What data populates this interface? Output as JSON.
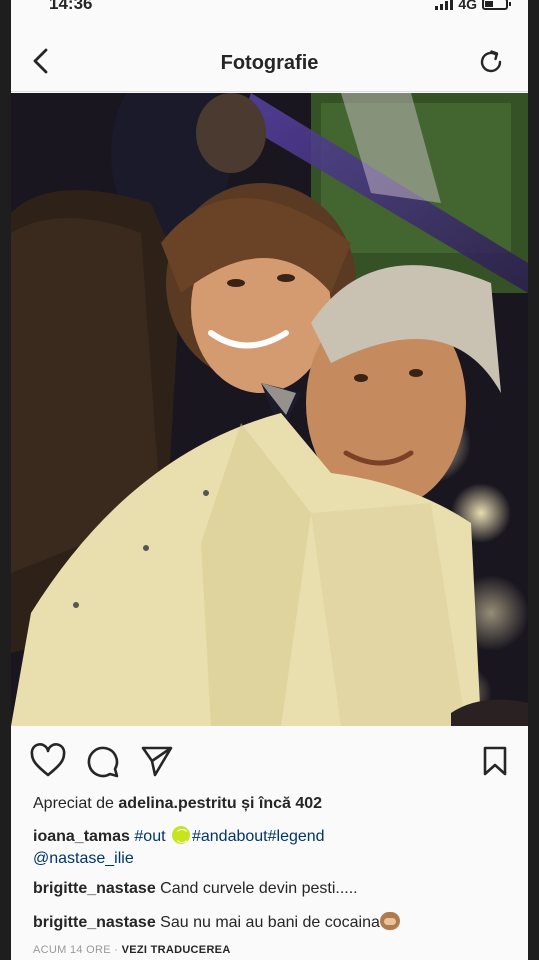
{
  "status_bar": {
    "time": "14:36",
    "network": "4G"
  },
  "header": {
    "title": "Fotografie"
  },
  "likes": {
    "prefix": "Apreciat de",
    "user": "adelina.pestritu",
    "suffix": "și încă 402"
  },
  "caption": {
    "user": "ioana_tamas",
    "tag1": "#out",
    "tag2": "#andabout#legend",
    "mention": "@nastase_ilie",
    "emoji": "tennis-ball-emoji"
  },
  "comments": [
    {
      "user": "brigitte_nastase",
      "text": "Cand curvele devin pesti....."
    },
    {
      "user": "brigitte_nastase",
      "text": "Sau nu mai au bani de cocaina",
      "emoji": "see-no-evil-monkey-emoji"
    }
  ],
  "meta": {
    "time_ago": "ACUM 14 ORE",
    "separator": "·",
    "translate": "VEZI TRADUCEREA"
  },
  "icons": {
    "back": "chevron-left-icon",
    "refresh": "refresh-icon",
    "like": "heart-icon",
    "comment": "comment-icon",
    "share": "send-icon",
    "save": "bookmark-icon"
  }
}
